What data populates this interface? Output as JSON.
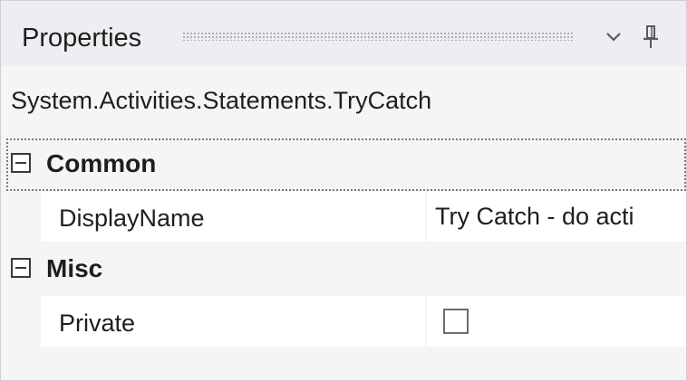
{
  "panel": {
    "title": "Properties",
    "dropdown_icon": "chevron-down-icon",
    "pin_icon": "pin-icon"
  },
  "selected_object": "System.Activities.Statements.TryCatch",
  "categories": [
    {
      "label": "Common",
      "expanded": true,
      "properties": [
        {
          "name": "DisplayName",
          "value": "Try Catch - do acti"
        }
      ]
    },
    {
      "label": "Misc",
      "expanded": true,
      "properties": [
        {
          "name": "Private",
          "checked": false
        }
      ]
    }
  ],
  "colors": {
    "panel_background": "#f5f5f5",
    "title_background": "#eeeef2",
    "row_background": "#ffffff",
    "text": "#1e1e1e"
  }
}
